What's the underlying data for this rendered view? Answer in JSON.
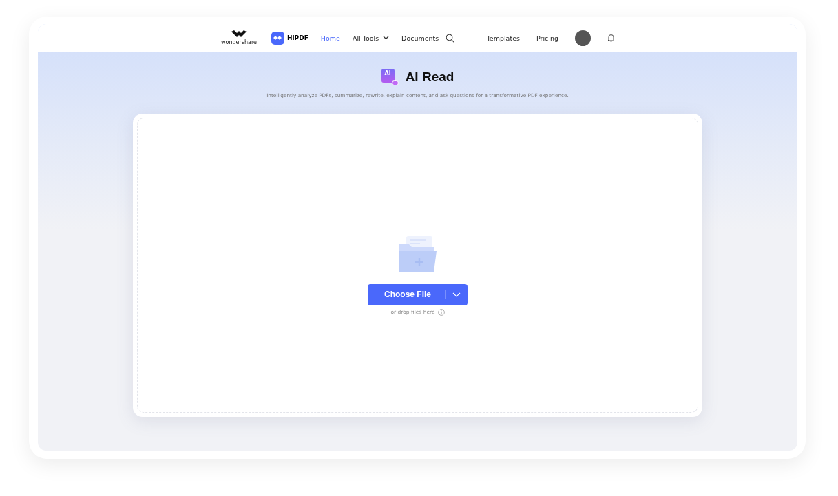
{
  "header": {
    "brand": "wondershare",
    "product": "HiPDF",
    "nav": [
      {
        "label": "Home",
        "selected": true,
        "kind": "link"
      },
      {
        "label": "All Tools",
        "selected": false,
        "kind": "dropdown"
      },
      {
        "label": "Documents",
        "selected": false,
        "kind": "link"
      }
    ],
    "right_nav": [
      "Templates",
      "Pricing"
    ]
  },
  "hero": {
    "badge": "AI",
    "title": "AI Read",
    "subtitle": "Intelligently analyze PDFs, summarize, rewrite, explain content, and ask questions for a transformative PDF experience."
  },
  "upload": {
    "button": "Choose File",
    "hint": "or drop files here"
  }
}
